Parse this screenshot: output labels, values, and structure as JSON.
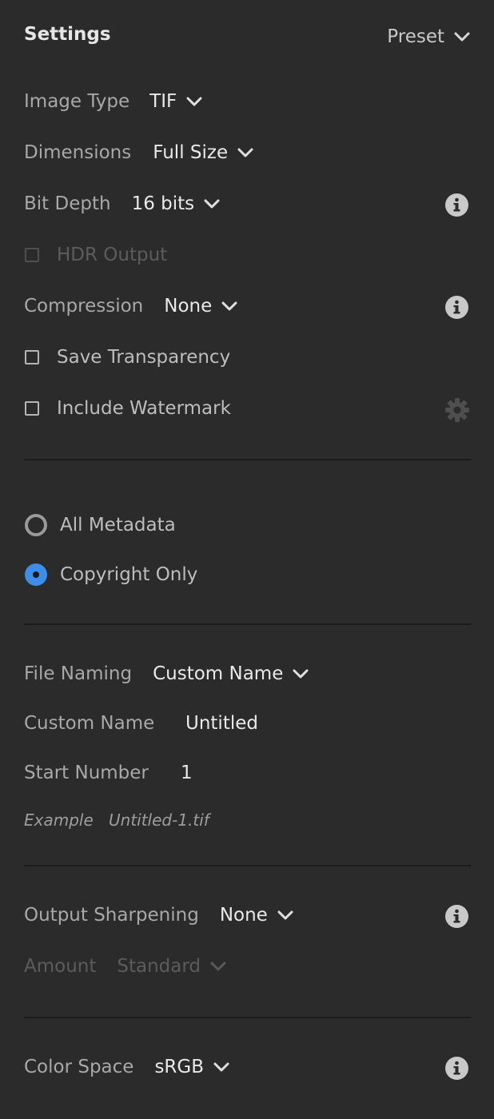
{
  "header": {
    "title": "Settings",
    "preset_label": "Preset"
  },
  "file_settings": {
    "image_type": {
      "label": "Image Type",
      "value": "TIF"
    },
    "dimensions": {
      "label": "Dimensions",
      "value": "Full Size"
    },
    "bit_depth": {
      "label": "Bit Depth",
      "value": "16 bits"
    },
    "hdr_output": {
      "label": "HDR Output",
      "checked": false,
      "enabled": false
    },
    "compression": {
      "label": "Compression",
      "value": "None"
    },
    "save_transparency": {
      "label": "Save Transparency",
      "checked": false
    },
    "include_watermark": {
      "label": "Include Watermark",
      "checked": false
    }
  },
  "metadata": {
    "options": [
      {
        "label": "All Metadata",
        "selected": false
      },
      {
        "label": "Copyright Only",
        "selected": true
      }
    ]
  },
  "file_naming": {
    "naming": {
      "label": "File Naming",
      "value": "Custom Name"
    },
    "custom_name": {
      "label": "Custom Name",
      "value": "Untitled"
    },
    "start_number": {
      "label": "Start Number",
      "value": "1"
    },
    "example": {
      "label": "Example",
      "value": "Untitled-1.tif"
    }
  },
  "sharpening": {
    "output": {
      "label": "Output Sharpening",
      "value": "None"
    },
    "amount": {
      "label": "Amount",
      "value": "Standard",
      "enabled": false
    }
  },
  "color": {
    "space": {
      "label": "Color Space",
      "value": "sRGB"
    }
  },
  "colors": {
    "background": "#2b2b2b",
    "accent": "#3d8ee8",
    "divider": "#1b1b1b"
  }
}
